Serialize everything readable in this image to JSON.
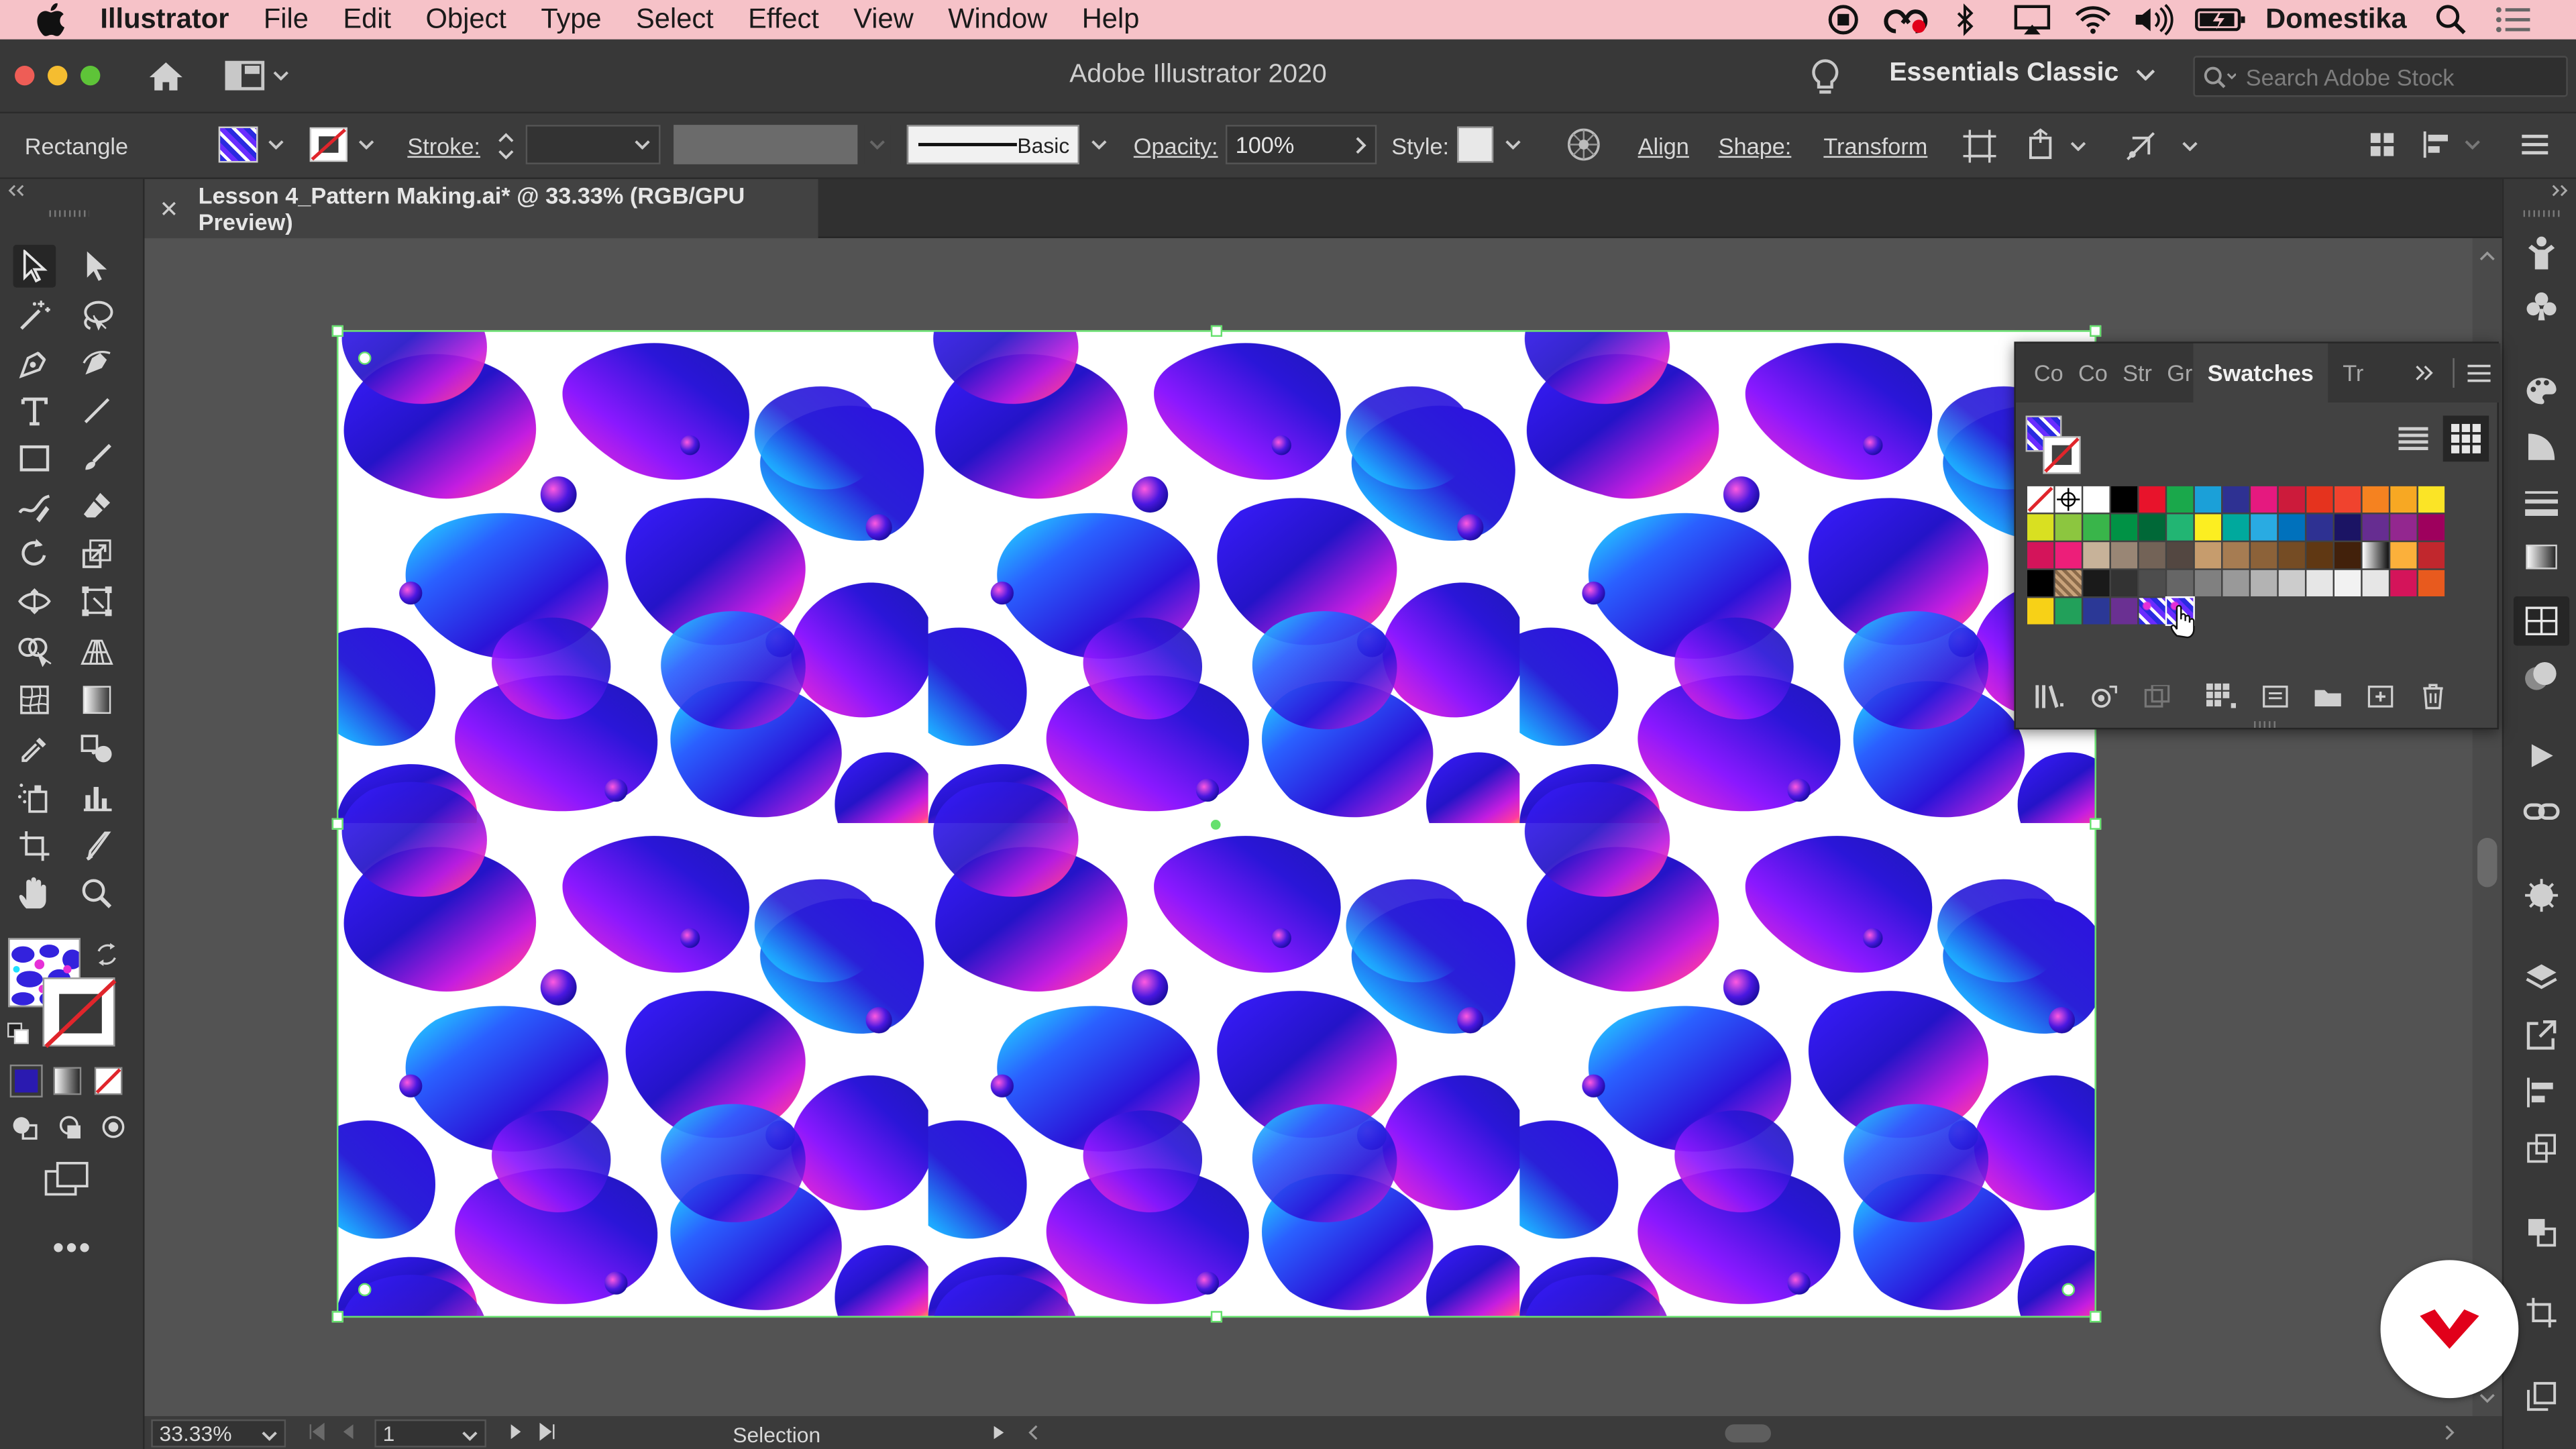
{
  "menubar": {
    "app_name": "Illustrator",
    "items": [
      "File",
      "Edit",
      "Object",
      "Type",
      "Select",
      "Effect",
      "View",
      "Window",
      "Help"
    ],
    "user": "Domestika"
  },
  "appbar": {
    "title": "Adobe Illustrator 2020",
    "workspace": "Essentials Classic",
    "search_placeholder": "Search Adobe Stock"
  },
  "control": {
    "selection_type": "Rectangle",
    "stroke_label": "Stroke:",
    "brush_label": "Basic",
    "opacity_label": "Opacity:",
    "opacity_value": "100%",
    "style_label": "Style:",
    "align_label": "Align",
    "shape_label": "Shape:",
    "transform_label": "Transform"
  },
  "document": {
    "tab_title": "Lesson 4_Pattern Making.ai* @ 33.33% (RGB/GPU Preview)"
  },
  "status": {
    "zoom": "33.33%",
    "artboard_number": "1",
    "tool_name": "Selection"
  },
  "swatches_panel": {
    "tabs": [
      "Co",
      "Co",
      "Str",
      "Gr",
      "Swatches",
      "Tr"
    ],
    "active_tab": "Swatches",
    "rows": [
      [
        "none",
        "registration",
        "#ffffff",
        "#000000",
        "#e8132b",
        "#1aa84b",
        "#1ba0d8",
        "#2e3192",
        "#e5197f",
        "#cc1b3b",
        "#e5331e",
        "#f0432e",
        "#f58220",
        "#f7a823",
        "#fbe426"
      ],
      [
        "#d9e021",
        "#8cc63f",
        "#39b54a",
        "#009245",
        "#006837",
        "#22b573",
        "#fcee21",
        "#00a99d",
        "#29abe2",
        "#0071bc",
        "#2e3192",
        "#1b1464",
        "#662d91",
        "#93278f",
        "#9e005d"
      ],
      [
        "#d4145a",
        "#ed1e79",
        "#c7b299",
        "#998675",
        "#736357",
        "#534741",
        "#c69c6d",
        "#a67c52",
        "#8c6239",
        "#754c24",
        "#603813",
        "#42210b",
        "gradient-bw",
        "#fbb03b",
        "#c1272d"
      ],
      [
        "#000000",
        "pattern-beige",
        "#1a1a1a",
        "#333333",
        "#4d4d4d",
        "#666666",
        "#808080",
        "#999999",
        "#b3b3b3",
        "#cccccc",
        "#e6e6e6",
        "#f2f2f2",
        "#e6e6e6",
        "#d4145a",
        "#e85a1e"
      ],
      [
        "#f7d117",
        "#22a05a",
        "#2b3896",
        "#6a3092",
        "pattern-blobs",
        "pattern-blobs-selected"
      ]
    ]
  },
  "colors": {
    "menubar_bg": "#f6c2c8",
    "selection_accent": "#66e06e",
    "domestika_red": "#e1001a"
  }
}
